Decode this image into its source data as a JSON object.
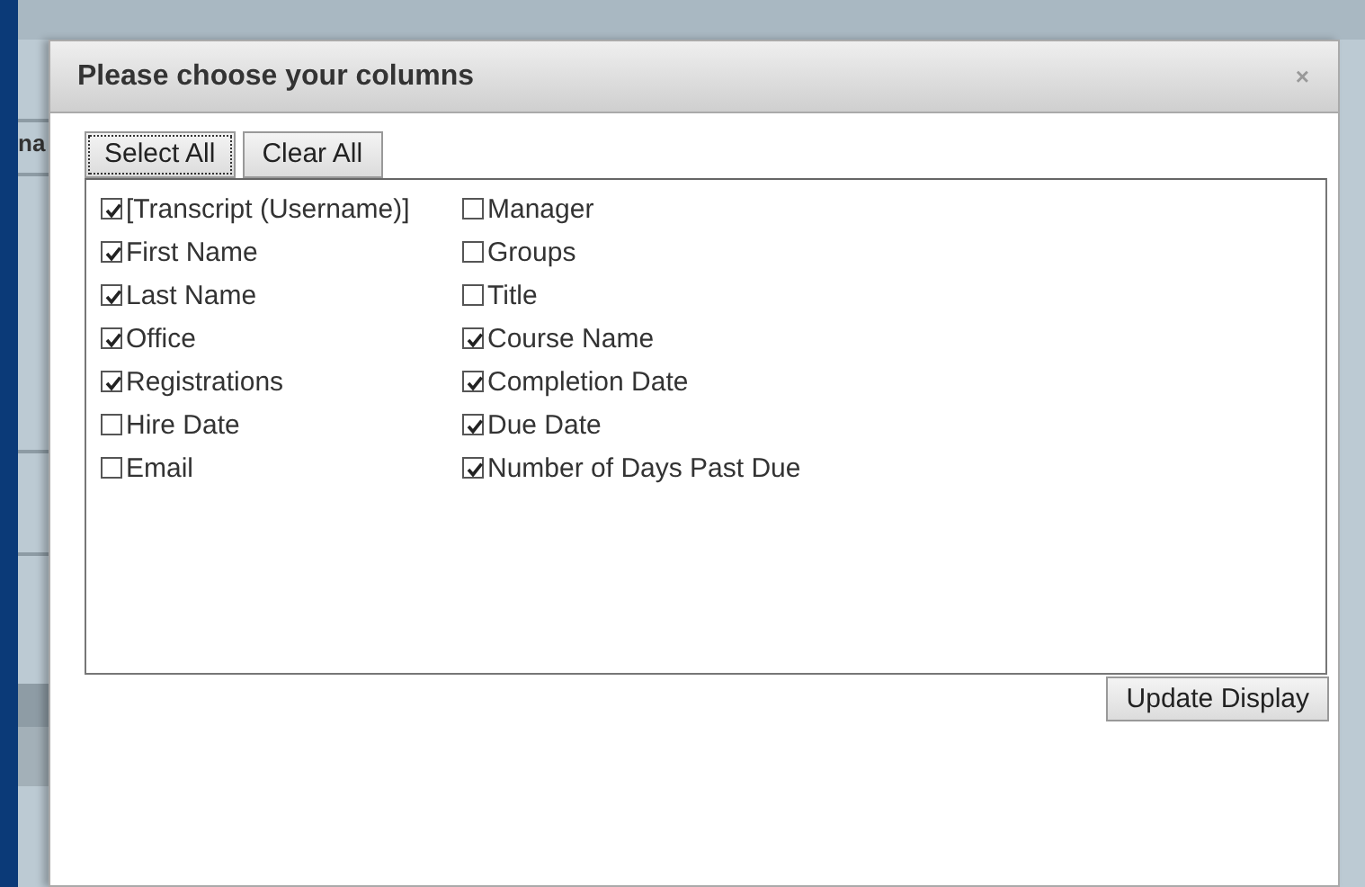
{
  "background": {
    "cut_text": "na"
  },
  "dialog": {
    "title": "Please choose your columns",
    "close": "×",
    "buttons": [
      {
        "label": "Select All",
        "focused": true
      },
      {
        "label": "Clear All",
        "focused": false
      }
    ],
    "columns": [
      [
        {
          "label": "[Transcript (Username)]",
          "checked": true
        },
        {
          "label": "First Name",
          "checked": true
        },
        {
          "label": "Last Name",
          "checked": true
        },
        {
          "label": "Office",
          "checked": true
        },
        {
          "label": "Registrations",
          "checked": true
        },
        {
          "label": "Hire Date",
          "checked": false
        },
        {
          "label": "Email",
          "checked": false
        }
      ],
      [
        {
          "label": "Manager",
          "checked": false
        },
        {
          "label": "Groups",
          "checked": false
        },
        {
          "label": "Title",
          "checked": false
        },
        {
          "label": "Course Name",
          "checked": true
        },
        {
          "label": "Completion Date",
          "checked": true
        },
        {
          "label": "Due Date",
          "checked": true
        },
        {
          "label": "Number of Days Past Due",
          "checked": true
        }
      ]
    ],
    "update_button": "Update Display"
  }
}
